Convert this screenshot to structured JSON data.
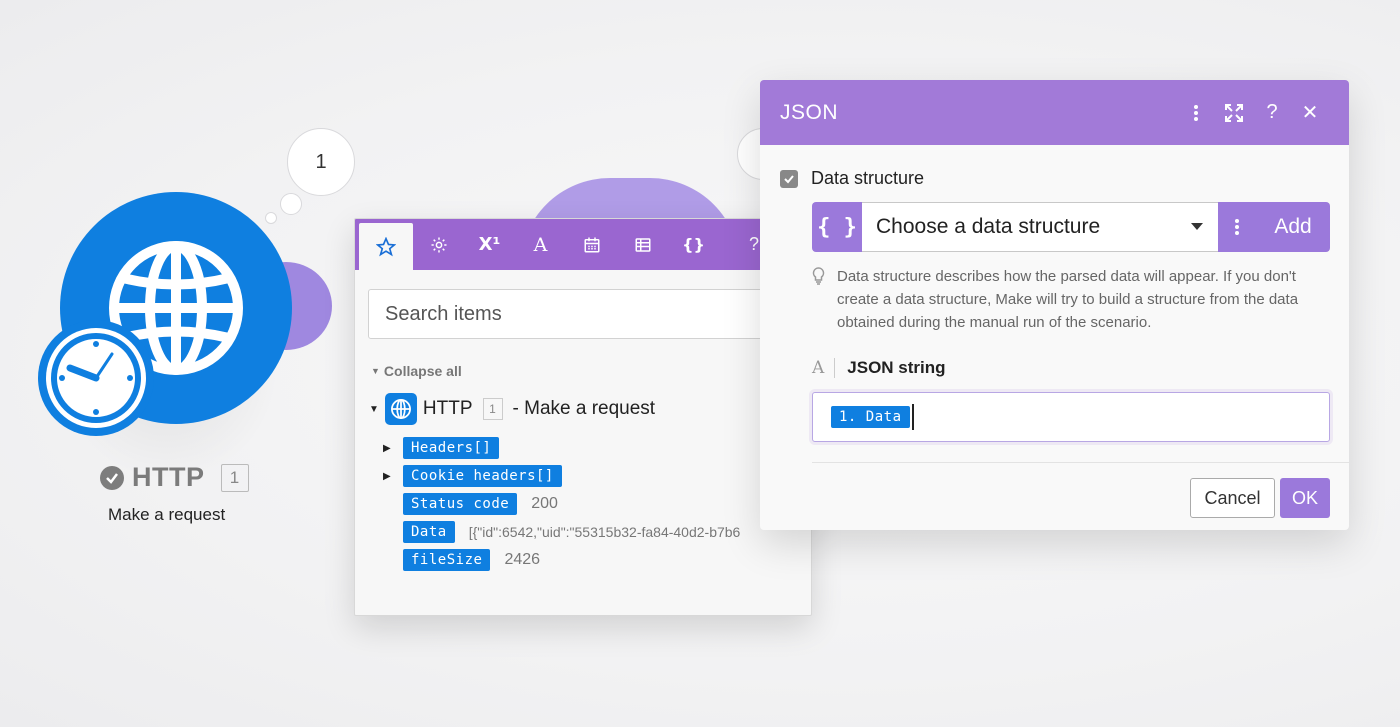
{
  "module": {
    "count_bubble": "1",
    "name": "HTTP",
    "id": "1",
    "subtitle": "Make a request",
    "icon": "globe-icon",
    "badge_icon": "clock-icon",
    "color": "#0f7fe0"
  },
  "items_panel": {
    "tabs": [
      {
        "icon": "star-icon"
      },
      {
        "icon": "gear-icon"
      },
      {
        "icon": "superscript-icon",
        "text": "X¹"
      },
      {
        "icon": "text-icon",
        "text": "A"
      },
      {
        "icon": "calendar-icon"
      },
      {
        "icon": "table-icon"
      },
      {
        "icon": "braces-icon",
        "text": "{}"
      }
    ],
    "help_label": "?",
    "close_label": "✕",
    "search_placeholder": "Search items",
    "collapse_all": "Collapse all",
    "root": {
      "name": "HTTP",
      "id": "1",
      "label": "- Make a request"
    },
    "items": [
      {
        "label": "Headers[]",
        "value": ""
      },
      {
        "label": "Cookie headers[]",
        "value": ""
      },
      {
        "label": "Status code",
        "value": "200"
      },
      {
        "label": "Data",
        "value": "[{\"id\":6542,\"uid\":\"55315b32-fa84-40d2-b7b6"
      },
      {
        "label": "fileSize",
        "value": "2426"
      }
    ],
    "header_color": "#9a66d0"
  },
  "json_panel": {
    "title": "JSON",
    "header_color": "#a27ad8",
    "data_structure_label": "Data structure",
    "select_placeholder": "Choose a data structure",
    "add_label": "Add",
    "help_text": "Data structure describes how the parsed data will appear. If you don't create a data structure, Make will try to build a structure from the data obtained during the manual run of the scenario.",
    "json_string_label": "JSON string",
    "json_string_value": "1. Data",
    "cancel_label": "Cancel",
    "ok_label": "OK"
  }
}
